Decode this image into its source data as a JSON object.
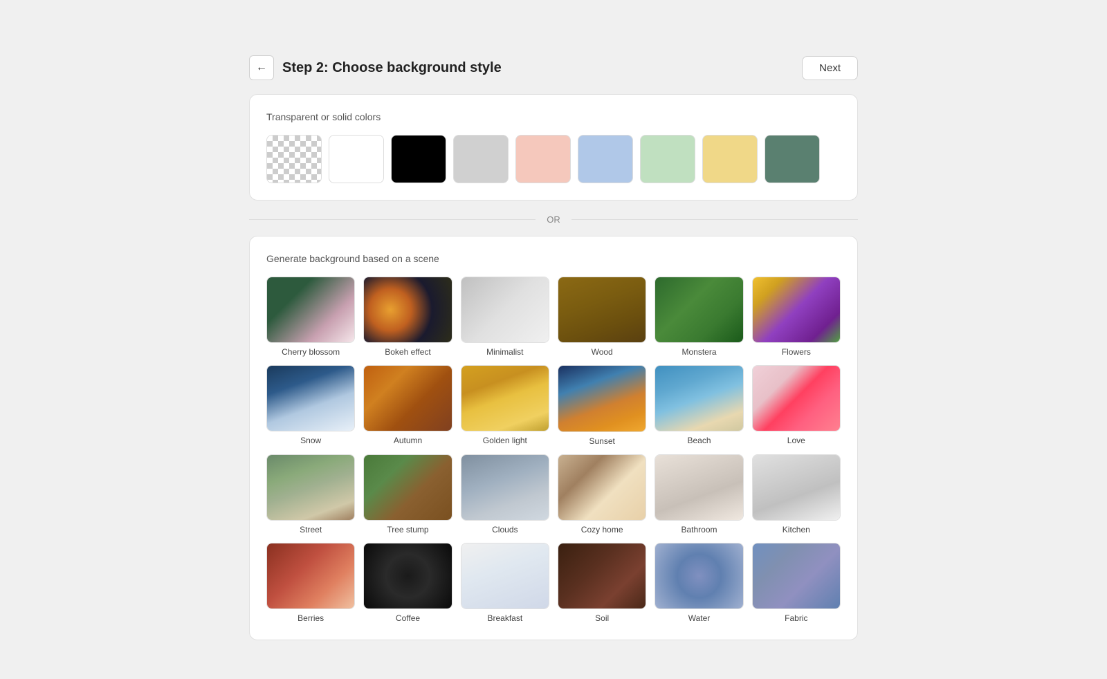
{
  "header": {
    "title": "Step 2: Choose background style",
    "next_label": "Next",
    "back_icon": "←"
  },
  "solid_colors": {
    "section_title": "Transparent or solid colors",
    "swatches": [
      {
        "id": "transparent",
        "type": "transparent",
        "label": "Transparent"
      },
      {
        "id": "white",
        "color": "#ffffff",
        "label": "White"
      },
      {
        "id": "black",
        "color": "#000000",
        "label": "Black"
      },
      {
        "id": "light-gray",
        "color": "#d0d0d0",
        "label": "Light gray"
      },
      {
        "id": "pink",
        "color": "#f5c8bc",
        "label": "Pink"
      },
      {
        "id": "blue",
        "color": "#b0c8e8",
        "label": "Blue"
      },
      {
        "id": "green",
        "color": "#c0e0c0",
        "label": "Green"
      },
      {
        "id": "yellow",
        "color": "#f0d888",
        "label": "Yellow"
      },
      {
        "id": "teal",
        "color": "#5a8070",
        "label": "Teal"
      }
    ]
  },
  "or_text": "OR",
  "scenes": {
    "section_title": "Generate background based on a scene",
    "items": [
      {
        "id": "cherry-blossom",
        "label": "Cherry blossom",
        "css_class": "scene-cherry-blossom"
      },
      {
        "id": "bokeh-effect",
        "label": "Bokeh effect",
        "css_class": "scene-bokeh"
      },
      {
        "id": "minimalist",
        "label": "Minimalist",
        "css_class": "scene-minimalist"
      },
      {
        "id": "wood",
        "label": "Wood",
        "css_class": "scene-wood"
      },
      {
        "id": "monstera",
        "label": "Monstera",
        "css_class": "scene-monstera"
      },
      {
        "id": "flowers",
        "label": "Flowers",
        "css_class": "scene-flowers"
      },
      {
        "id": "snow",
        "label": "Snow",
        "css_class": "scene-snow"
      },
      {
        "id": "autumn",
        "label": "Autumn",
        "css_class": "scene-autumn"
      },
      {
        "id": "golden-light",
        "label": "Golden light",
        "css_class": "scene-golden-light"
      },
      {
        "id": "sunset",
        "label": "Sunset",
        "css_class": "scene-sunset"
      },
      {
        "id": "beach",
        "label": "Beach",
        "css_class": "scene-beach"
      },
      {
        "id": "love",
        "label": "Love",
        "css_class": "scene-love"
      },
      {
        "id": "street",
        "label": "Street",
        "css_class": "scene-street"
      },
      {
        "id": "tree-stump",
        "label": "Tree stump",
        "css_class": "scene-tree-stump"
      },
      {
        "id": "clouds",
        "label": "Clouds",
        "css_class": "scene-clouds"
      },
      {
        "id": "cozy-home",
        "label": "Cozy home",
        "css_class": "scene-cozy-home"
      },
      {
        "id": "bathroom",
        "label": "Bathroom",
        "css_class": "scene-bathroom"
      },
      {
        "id": "kitchen",
        "label": "Kitchen",
        "css_class": "scene-kitchen"
      },
      {
        "id": "row4a",
        "label": "Berries",
        "css_class": "scene-row4a"
      },
      {
        "id": "row4b",
        "label": "Coffee",
        "css_class": "scene-row4b"
      },
      {
        "id": "row4c",
        "label": "Breakfast",
        "css_class": "scene-row4c"
      },
      {
        "id": "row4d",
        "label": "Soil",
        "css_class": "scene-row4d"
      },
      {
        "id": "row4e",
        "label": "Water",
        "css_class": "scene-row4e"
      },
      {
        "id": "row4f",
        "label": "Fabric",
        "css_class": "scene-row4f"
      }
    ]
  }
}
